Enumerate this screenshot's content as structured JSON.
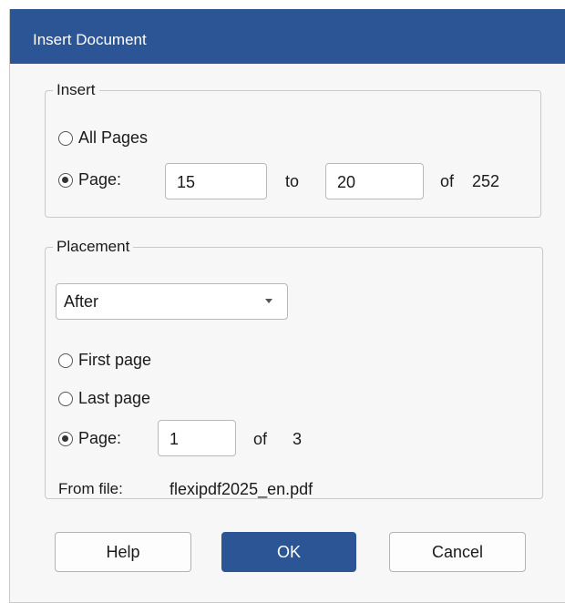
{
  "window": {
    "title": "Insert Document"
  },
  "insert": {
    "legend": "Insert",
    "all_pages_label": "All Pages",
    "page_label": "Page:",
    "from_value": "15",
    "to_label": "to",
    "to_value": "20",
    "of_label": "of",
    "total_pages": "252",
    "selected": "page"
  },
  "placement": {
    "legend": "Placement",
    "position_select": "After",
    "first_page_label": "First page",
    "last_page_label": "Last page",
    "page_label": "Page:",
    "page_value": "1",
    "of_label": "of",
    "total_pages": "3",
    "selected": "page",
    "from_file_label": "From file:",
    "from_file_value": "flexipdf2025_en.pdf"
  },
  "buttons": {
    "help": "Help",
    "ok": "OK",
    "cancel": "Cancel"
  },
  "colors": {
    "accent": "#2c5596"
  }
}
